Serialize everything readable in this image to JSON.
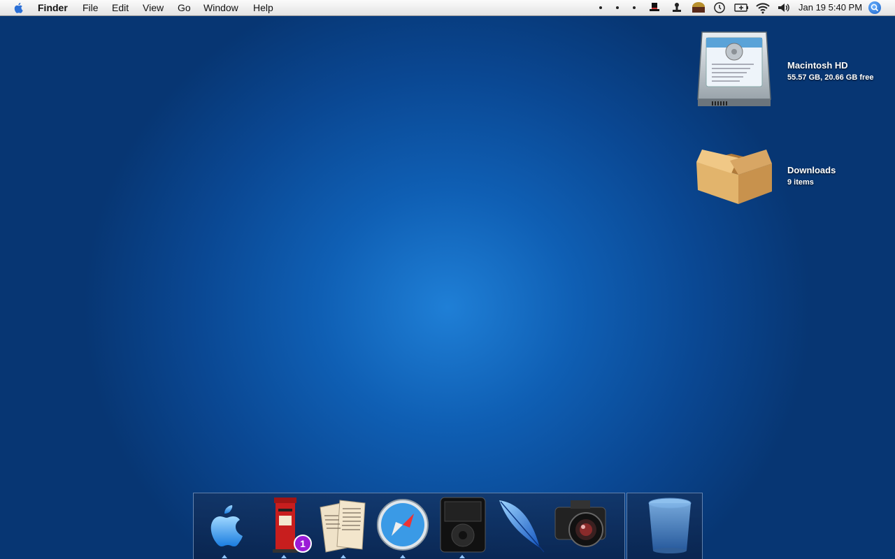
{
  "menubar": {
    "app_name": "Finder",
    "menus": [
      "File",
      "Edit",
      "View",
      "Go",
      "Window",
      "Help"
    ],
    "clock": "Jan 19  5:40 PM"
  },
  "desktop": {
    "items": [
      {
        "title": "Macintosh HD",
        "subtitle": "55.57 GB, 20.66 GB free",
        "icon": "hard-drive-icon"
      },
      {
        "title": "Downloads",
        "subtitle": "9 items",
        "icon": "box-folder-icon"
      }
    ]
  },
  "dock": {
    "items": [
      {
        "icon": "apple-logo-icon",
        "running": true
      },
      {
        "icon": "mailbox-icon",
        "running": true,
        "badge": "1"
      },
      {
        "icon": "newspapers-icon",
        "running": true
      },
      {
        "icon": "safari-compass-icon",
        "running": true
      },
      {
        "icon": "ipod-icon",
        "running": true
      },
      {
        "icon": "feather-icon",
        "running": false
      },
      {
        "icon": "camera-icon",
        "running": false
      }
    ],
    "trash": {
      "icon": "trash-icon"
    }
  },
  "colors": {
    "desktop_center": "#1f7fd6",
    "desktop_edge": "#073673",
    "badge": "#9b1bd6"
  }
}
